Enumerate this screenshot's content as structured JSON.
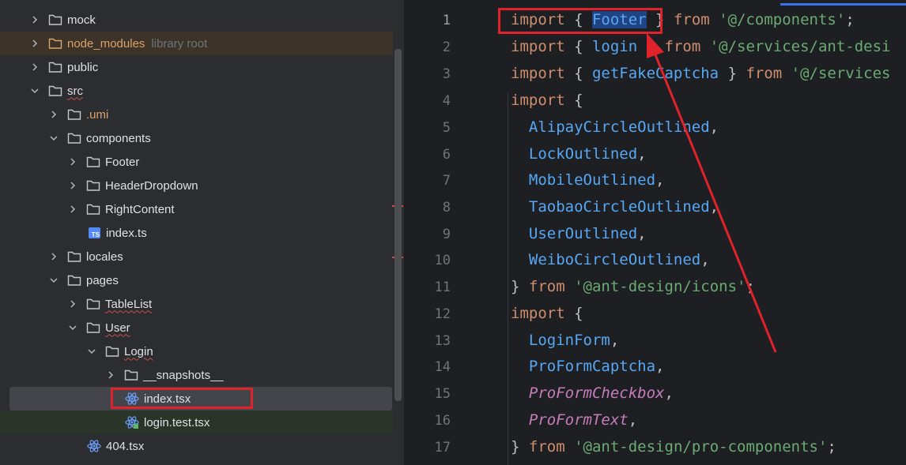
{
  "project_tree": {
    "items": [
      {
        "label": "mock",
        "type": "folder",
        "expanded": false
      },
      {
        "label": "node_modules",
        "hint": "library root",
        "type": "folder",
        "expanded": false,
        "excluded": true
      },
      {
        "label": "public",
        "type": "folder",
        "expanded": false
      },
      {
        "label": "src",
        "type": "folder",
        "expanded": true
      },
      {
        "label": ".umi",
        "type": "folder",
        "expanded": false
      },
      {
        "label": "components",
        "type": "folder",
        "expanded": true
      },
      {
        "label": "Footer",
        "type": "folder",
        "expanded": false
      },
      {
        "label": "HeaderDropdown",
        "type": "folder",
        "expanded": false
      },
      {
        "label": "RightContent",
        "type": "folder",
        "expanded": false
      },
      {
        "label": "index.ts",
        "type": "ts-file",
        "badge": "TS"
      },
      {
        "label": "locales",
        "type": "folder",
        "expanded": false
      },
      {
        "label": "pages",
        "type": "folder",
        "expanded": true
      },
      {
        "label": "TableList",
        "type": "folder",
        "expanded": false
      },
      {
        "label": "User",
        "type": "folder",
        "expanded": true
      },
      {
        "label": "Login",
        "type": "folder",
        "expanded": true
      },
      {
        "label": "__snapshots__",
        "type": "folder",
        "expanded": false
      },
      {
        "label": "index.tsx",
        "type": "react-file",
        "selected": true
      },
      {
        "label": "login.test.tsx",
        "type": "react-test-file"
      },
      {
        "label": "404.tsx",
        "type": "react-file"
      }
    ]
  },
  "editor": {
    "line_numbers": [
      "1",
      "2",
      "3",
      "4",
      "5",
      "6",
      "7",
      "8",
      "9",
      "10",
      "11",
      "12",
      "13",
      "14",
      "15",
      "16",
      "17"
    ],
    "lines": [
      {
        "l1": "import",
        "l2": " { ",
        "l3": "Footer",
        "l4": " } ",
        "l5": "from",
        "l6": " ",
        "l7": "'@/components'",
        "l8": ";"
      },
      {
        "l1": "import",
        "l2": " { ",
        "l3": "login",
        "l4": " } ",
        "l5": "from",
        "l6": " ",
        "l7": "'@/services/ant-desi",
        "l8": ""
      },
      {
        "l1": "import",
        "l2": " { ",
        "l3": "getFakeCaptcha",
        "l4": " } ",
        "l5": "from",
        "l6": " ",
        "l7": "'@/services",
        "l8": ""
      },
      {
        "l1": "import",
        "l2": " {",
        "l3": "",
        "l4": "",
        "l5": "",
        "l6": "",
        "l7": "",
        "l8": ""
      },
      {
        "l1": "  ",
        "l2": "AlipayCircleOutlined",
        "l3": ","
      },
      {
        "l1": "  ",
        "l2": "LockOutlined",
        "l3": ","
      },
      {
        "l1": "  ",
        "l2": "MobileOutlined",
        "l3": ","
      },
      {
        "l1": "  ",
        "l2": "TaobaoCircleOutlined",
        "l3": ","
      },
      {
        "l1": "  ",
        "l2": "UserOutlined",
        "l3": ","
      },
      {
        "l1": "  ",
        "l2": "WeiboCircleOutlined",
        "l3": ","
      },
      {
        "l1": "} ",
        "l2": "from",
        "l3": " ",
        "l4": "'@ant-design/icons'",
        "l5": ";"
      },
      {
        "l1": "import",
        "l2": " {"
      },
      {
        "l1": "  ",
        "l2": "LoginForm",
        "l3": ","
      },
      {
        "l1": "  ",
        "l2": "ProFormCaptcha",
        "l3": ","
      },
      {
        "l1": "  ",
        "l2": "ProFormCheckbox",
        "l3": ","
      },
      {
        "l1": "  ",
        "l2": "ProFormText",
        "l3": ","
      },
      {
        "l1": "} ",
        "l2": "from",
        "l3": " ",
        "l4": "'@ant-design/pro-components'",
        "l5": ";"
      }
    ]
  },
  "colors": {
    "keyword": "#cf8e6d",
    "string": "#6aab73",
    "identifier": "#56a8f5",
    "italic_identifier": "#c77dbb",
    "annotation": "#e0222b"
  }
}
